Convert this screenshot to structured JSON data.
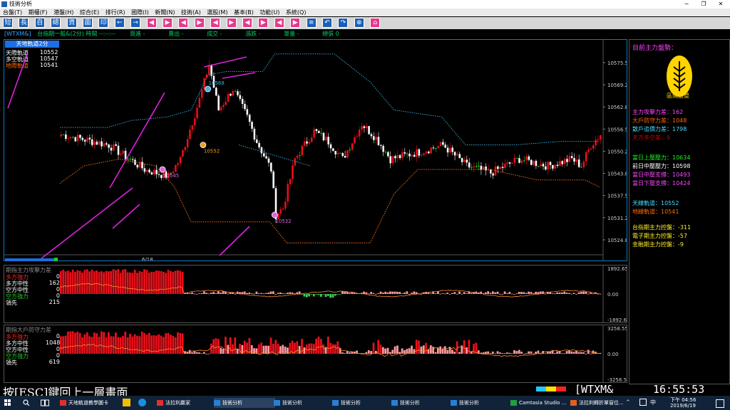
{
  "window": {
    "title": "技術分析",
    "controls": [
      "─",
      "❐",
      "✕"
    ]
  },
  "menu": [
    {
      "label": "台盤(T)"
    },
    {
      "label": "期權(F)"
    },
    {
      "label": "港盤(H)"
    },
    {
      "label": "綜合(E)"
    },
    {
      "label": "排行(R)"
    },
    {
      "label": "國際(I)"
    },
    {
      "label": "新聞(N)"
    },
    {
      "label": "技術(A)"
    },
    {
      "label": "選股(M)"
    },
    {
      "label": "基本(B)"
    },
    {
      "label": "功能(U)"
    },
    {
      "label": "系統(Q)"
    }
  ],
  "toolbar": [
    "短",
    "長",
    "自",
    "總",
    "資",
    "圖",
    "印",
    "←",
    "→",
    "◀",
    "▶",
    "◀",
    "▶",
    "◀",
    "▶",
    "◀",
    "▶",
    "◀",
    "▶",
    "≡",
    "↶",
    "↷",
    "⊗",
    "⌂"
  ],
  "infobar": {
    "symbol": "[WTXM&]",
    "name": "台指期一般&(2分) 時間 --:--:--",
    "buy": "買進 -",
    "sell": "賣出 -",
    "deal": "成交 -",
    "change": "漲跌 -",
    "volume": "單量 -",
    "total": "總張 0"
  },
  "main_legend": {
    "title": "天地軌道2分",
    "rows": [
      {
        "label": "天際軌道",
        "value": "10552",
        "color": "#ffffff"
      },
      {
        "label": "多空軌道",
        "value": "10547",
        "color": "#ffffff"
      },
      {
        "label": "地際軌道",
        "value": "10541",
        "color": "#ff6a00"
      }
    ]
  },
  "chart_data": [
    {
      "type": "candlestick",
      "title": "天地軌道2分",
      "y_ticks": [
        "10575.53",
        "10569.20",
        "10562.87",
        "10556.54",
        "10550.20",
        "10543.87",
        "10537.54",
        "10531.21",
        "10524.87"
      ],
      "ylim": [
        10521,
        10580
      ],
      "x_label": "6/18",
      "marks": [
        {
          "label": "10568",
          "value": 10568
        },
        {
          "label": "10552",
          "value": 10552
        },
        {
          "label": "10545",
          "value": 10545
        },
        {
          "label": "10532",
          "value": 10532
        }
      ]
    },
    {
      "type": "bar",
      "title": "期指主力攻擊力差",
      "y_ticks": [
        "1892.65",
        "0.00",
        "-1892.65"
      ],
      "ylim": [
        -1892.65,
        1892.65
      ]
    },
    {
      "type": "bar",
      "title": "期指大戶防守力差",
      "y_ticks": [
        "3258.55",
        "0.00",
        "-3258.55"
      ],
      "ylim": [
        -3258.55,
        3258.55
      ]
    }
  ],
  "panel1": {
    "title": "期指主力攻擊力差",
    "rows": [
      {
        "label": "多方強力",
        "value": "0",
        "color": "#ff2020"
      },
      {
        "label": "多方中性",
        "value": "162",
        "color": "#ffffff"
      },
      {
        "label": "空方中性",
        "value": "0",
        "color": "#ffffff"
      },
      {
        "label": "空方強力",
        "value": "0",
        "color": "#22cc22"
      },
      {
        "label": "領先",
        "value": "215",
        "color": "#ffffff"
      }
    ]
  },
  "panel2": {
    "title": "期指大戶防守力差",
    "rows": [
      {
        "label": "多方強力",
        "value": "0",
        "color": "#ff2020"
      },
      {
        "label": "多方中性",
        "value": "1048",
        "color": "#ffffff"
      },
      {
        "label": "空方中性",
        "value": "0",
        "color": "#ffffff"
      },
      {
        "label": "空方強力",
        "value": "0",
        "color": "#22cc22"
      },
      {
        "label": "領先",
        "value": "619",
        "color": "#ffffff"
      }
    ]
  },
  "right_panel": {
    "heading": "目前主力盤勢：",
    "badge_label": "區間盤整",
    "stats": [
      {
        "label": "主力攻擊力差：162",
        "color": "#ff44ff"
      },
      {
        "label": "大戶防守力差：1048",
        "color": "#ff6a00"
      },
      {
        "label": "散戶追價力差：1798",
        "color": "#44ddff"
      },
      {
        "label": "天方多空差：9",
        "color": "#cc0000"
      },
      {
        "label": "當日上壓壓力：10634",
        "color": "#22ee22"
      },
      {
        "label": "前日中壓壓力：10598",
        "color": "#ffffff"
      },
      {
        "label": "當日中壓支撐：10493",
        "color": "#ff44ff"
      },
      {
        "label": "當日下壓支撐：10424",
        "color": "#ff44ff"
      },
      {
        "label": "天線軌道：10552",
        "color": "#44ddff"
      },
      {
        "label": "地線軌道：10541",
        "color": "#ff6a00"
      },
      {
        "label": "台指期主力控盤：-311",
        "color": "#ffee22"
      },
      {
        "label": "電子期主力控盤：-57",
        "color": "#ffee22"
      },
      {
        "label": "金融期主力控盤：-9",
        "color": "#ffee22"
      }
    ]
  },
  "bottom": {
    "message": "按[ESC]鍵回上一層畫面",
    "symbol": "[WTXM&",
    "clock": "16:55:53"
  },
  "taskbar": {
    "items": [
      {
        "label": "天地軌道教學圖卡"
      },
      {
        "label": "法拉利贏家"
      },
      {
        "label": "技術分析"
      },
      {
        "label": "技術分析"
      },
      {
        "label": "技術分析"
      },
      {
        "label": "技術分析"
      },
      {
        "label": "技術分析"
      },
      {
        "label": "Camtasia Studio ..."
      },
      {
        "label": "法拉利轉折單窗位..."
      }
    ],
    "ime": "中",
    "time": "下午 04:56",
    "date": "2019/6/19"
  },
  "colors": {
    "up": "#e8101a",
    "down": "#ffffff",
    "neutral": "#22cc22",
    "line_cyan": "#3ab4e0",
    "line_orange": "#ff7a1a",
    "annotation": "#dd22dd"
  }
}
